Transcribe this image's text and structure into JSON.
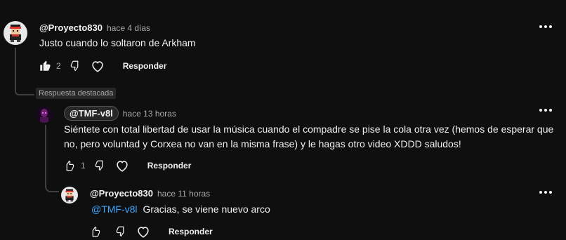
{
  "comments": [
    {
      "author": "@Proyecto830",
      "time": "hace 4 días",
      "text": "Justo cuando lo soltaron de Arkham",
      "likes": "2",
      "reply_label": "Responder"
    },
    {
      "badge": "Respuesta destacada",
      "author": "@TMF-v8l",
      "time": "hace 13 horas",
      "text_line1": "Siéntete con total libertad de usar la música cuando el compadre se pise la cola otra vez (hemos de esperar que",
      "text_line2": "no, pero voluntad y Corxea no van en la misma frase) y le hagas otro video XDDD saludos!",
      "likes": "1",
      "reply_label": "Responder"
    },
    {
      "author": "@Proyecto830",
      "time": "hace 11 horas",
      "mention": "@TMF-v8l",
      "text": "Gracias, se viene nuevo arco",
      "reply_label": "Responder"
    }
  ],
  "colors": {
    "background": "#0f0f0f",
    "text": "#f1f1f1",
    "muted": "#aaaaaa",
    "mention": "#3ea6ff"
  }
}
